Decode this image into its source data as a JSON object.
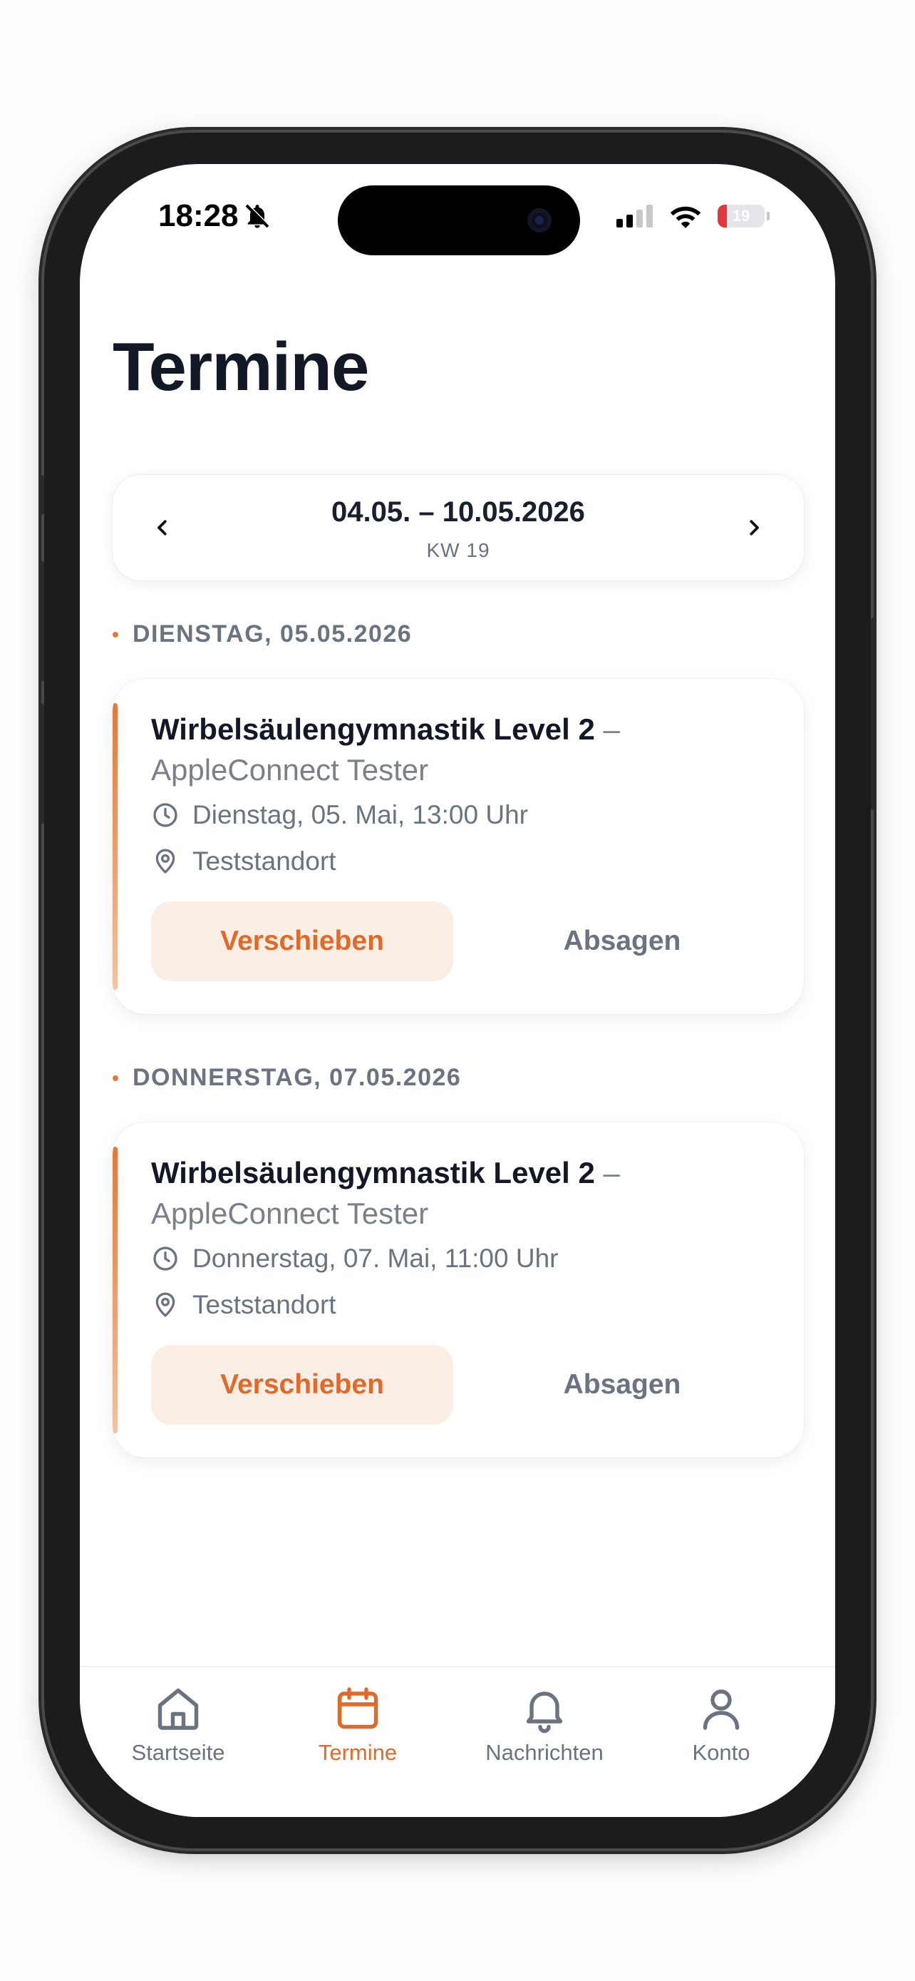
{
  "status_bar": {
    "time": "18:28",
    "battery": "19"
  },
  "page": {
    "title": "Termine"
  },
  "week_nav": {
    "range": "04.05. – 10.05.2026",
    "week": "KW 19"
  },
  "days": [
    {
      "header": "DIENSTAG, 05.05.2026",
      "appointment": {
        "title": "Wirbelsäulengymnastik Level 2",
        "separator": " –",
        "subtitle": "AppleConnect Tester",
        "datetime": "Dienstag, 05. Mai, 13:00 Uhr",
        "location": "Teststandort",
        "primary_action": "Verschieben",
        "secondary_action": "Absagen"
      }
    },
    {
      "header": "DONNERSTAG, 07.05.2026",
      "appointment": {
        "title": "Wirbelsäulengymnastik Level 2",
        "separator": " –",
        "subtitle": "AppleConnect Tester",
        "datetime": "Donnerstag, 07. Mai, 11:00 Uhr",
        "location": "Teststandort",
        "primary_action": "Verschieben",
        "secondary_action": "Absagen"
      }
    }
  ],
  "tabbar": {
    "items": [
      {
        "label": "Startseite",
        "icon": "home-icon",
        "active": false
      },
      {
        "label": "Termine",
        "icon": "calendar-icon",
        "active": true
      },
      {
        "label": "Nachrichten",
        "icon": "bell-icon",
        "active": false
      },
      {
        "label": "Konto",
        "icon": "user-icon",
        "active": false
      }
    ]
  },
  "colors": {
    "accent": "#df6a2a",
    "accent_soft": "#fbeee5",
    "text": "#141826",
    "muted": "#6b7280"
  }
}
